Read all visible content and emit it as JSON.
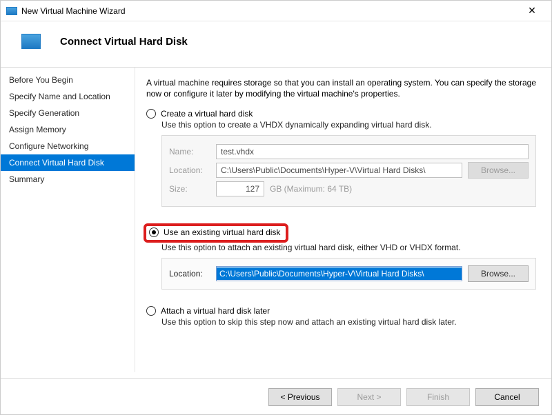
{
  "window": {
    "title": "New Virtual Machine Wizard",
    "close": "✕"
  },
  "header": {
    "heading": "Connect Virtual Hard Disk"
  },
  "sidebar": {
    "steps": [
      "Before You Begin",
      "Specify Name and Location",
      "Specify Generation",
      "Assign Memory",
      "Configure Networking",
      "Connect Virtual Hard Disk",
      "Summary"
    ],
    "selectedIndex": 5
  },
  "main": {
    "intro": "A virtual machine requires storage so that you can install an operating system. You can specify the storage now or configure it later by modifying the virtual machine's properties.",
    "option1": {
      "label": "Create a virtual hard disk",
      "desc": "Use this option to create a VHDX dynamically expanding virtual hard disk.",
      "name_label": "Name:",
      "name_value": "test.vhdx",
      "location_label": "Location:",
      "location_value": "C:\\Users\\Public\\Documents\\Hyper-V\\Virtual Hard Disks\\",
      "browse": "Browse...",
      "size_label": "Size:",
      "size_value": "127",
      "size_unit": "GB (Maximum: 64 TB)"
    },
    "option2": {
      "label": "Use an existing virtual hard disk",
      "desc": "Use this option to attach an existing virtual hard disk, either VHD or VHDX format.",
      "location_label": "Location:",
      "location_value": "C:\\Users\\Public\\Documents\\Hyper-V\\Virtual Hard Disks\\",
      "browse": "Browse..."
    },
    "option3": {
      "label": "Attach a virtual hard disk later",
      "desc": "Use this option to skip this step now and attach an existing virtual hard disk later."
    }
  },
  "footer": {
    "previous": "< Previous",
    "next": "Next >",
    "finish": "Finish",
    "cancel": "Cancel"
  }
}
